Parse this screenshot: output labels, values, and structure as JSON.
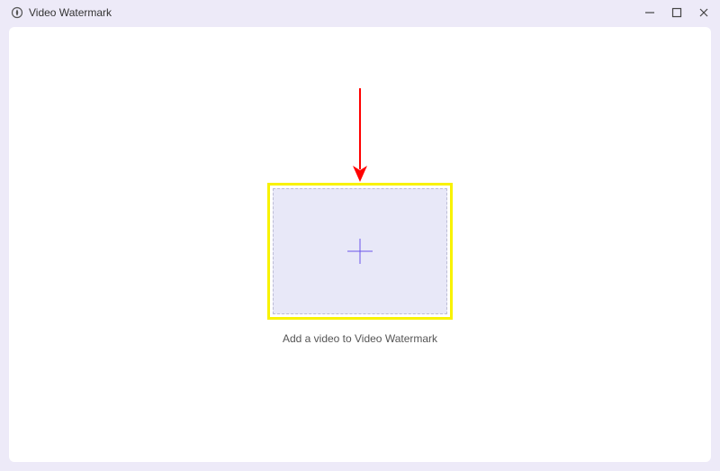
{
  "titlebar": {
    "app_title": "Video Watermark"
  },
  "main": {
    "drop_label": "Add a video to Video Watermark"
  }
}
